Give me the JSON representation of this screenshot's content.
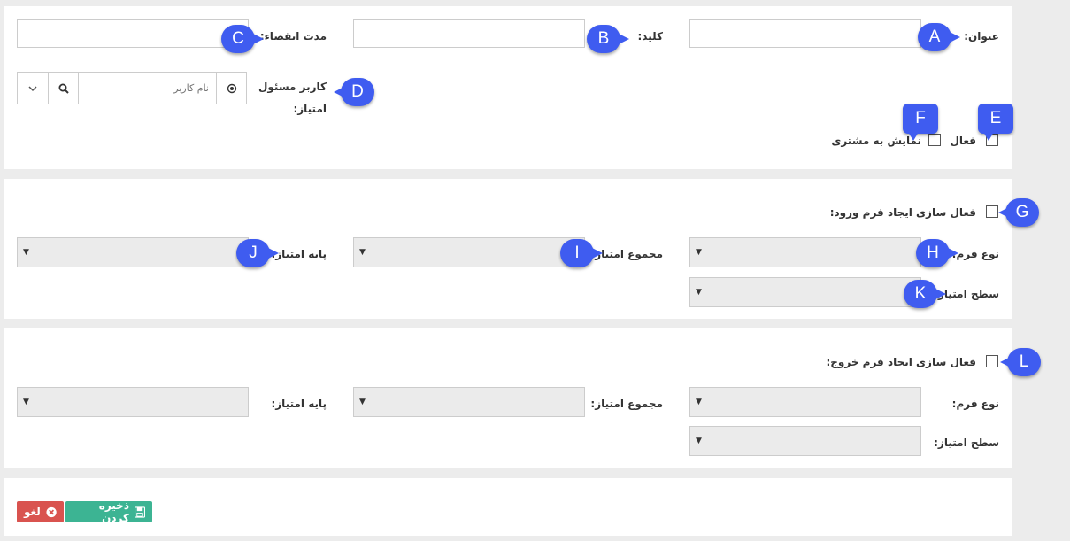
{
  "section1": {
    "title_label": "عنوان:",
    "key_label": "کلید:",
    "expiry_label": "مدت انقضاء:",
    "responsible_user_label": "کاربر مسئول",
    "score_label": "امتیاز:",
    "username_placeholder": "نام کاربر",
    "active_label": "فعال",
    "show_to_customer_label": "نمایش به مشتری"
  },
  "section2": {
    "enable_entry_form_label": "فعال سازی ایجاد فرم ورود:",
    "form_type_label": "نوع فرم:",
    "score_total_label": "مجموع امتیاز:",
    "score_base_label": "پایه امتیاز:",
    "score_level_label": "سطح امتیاز:"
  },
  "section3": {
    "enable_exit_form_label": "فعال سازی ایجاد فرم خروج:",
    "form_type_label": "نوع فرم:",
    "score_total_label": "مجموع امتیاز:",
    "score_base_label": "پایه امتیاز:",
    "score_level_label": "سطح امتیاز:"
  },
  "actions": {
    "save_label": "ذخیره کردن",
    "cancel_label": "لغو"
  },
  "callouts": {
    "a": "A",
    "b": "B",
    "c": "C",
    "d": "D",
    "e": "E",
    "f": "F",
    "g": "G",
    "h": "H",
    "i": "I",
    "j": "J",
    "k": "K",
    "l": "L"
  },
  "colors": {
    "callout": "#3f5cf0",
    "save": "#3cb493",
    "cancel": "#d9534f",
    "panel_bg": "#ffffff",
    "page_bg": "#ececec"
  }
}
